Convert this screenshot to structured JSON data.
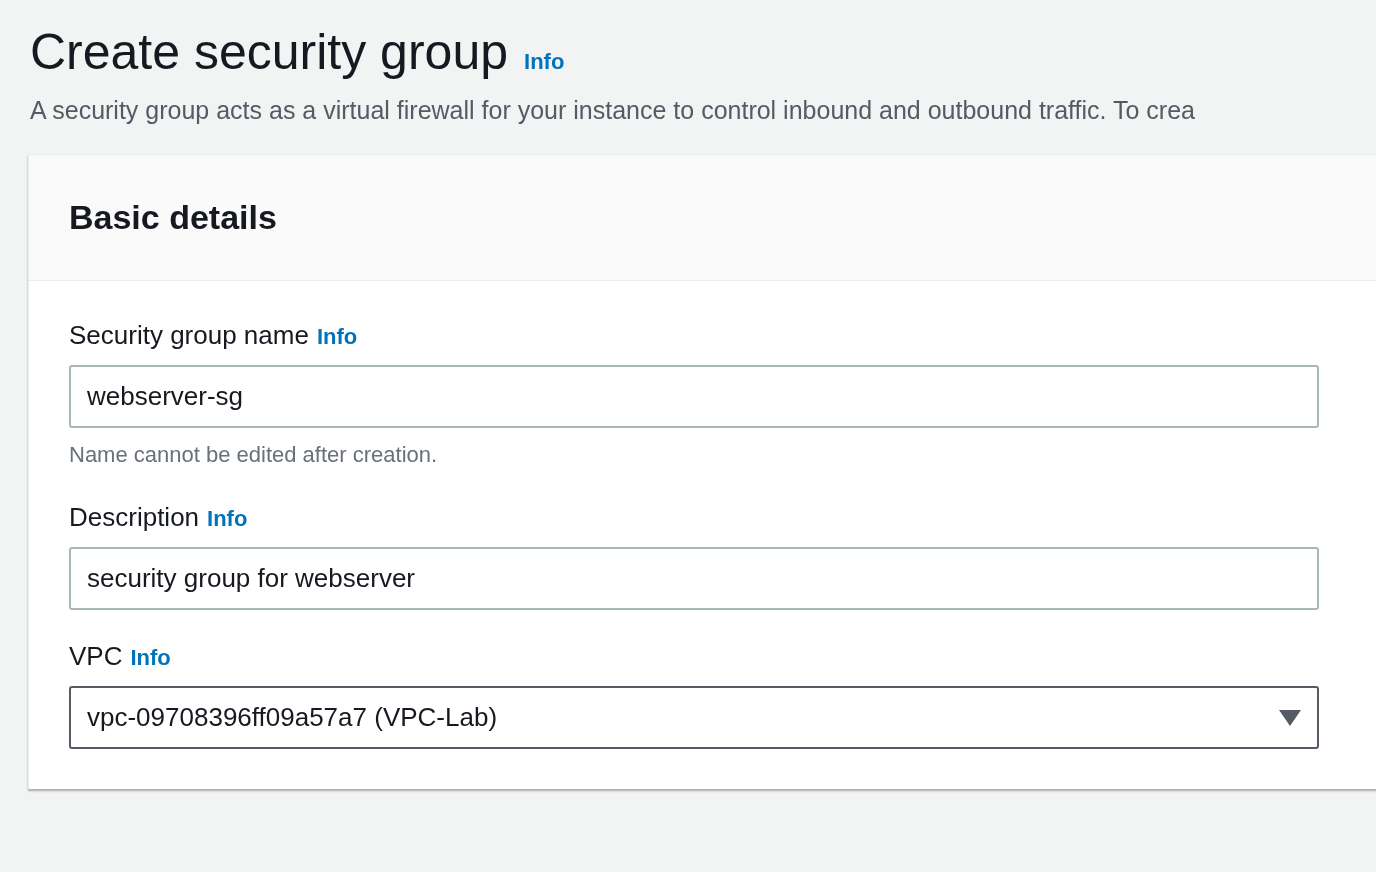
{
  "header": {
    "title": "Create security group",
    "info": "Info",
    "description": "A security group acts as a virtual firewall for your instance to control inbound and outbound traffic. To crea"
  },
  "panel": {
    "title": "Basic details",
    "fields": [
      {
        "kind": "text",
        "label": "Security group name",
        "info": "Info",
        "value": "webserver-sg",
        "hint": "Name cannot be edited after creation."
      },
      {
        "kind": "text",
        "label": "Description",
        "info": "Info",
        "value": "security group for webserver"
      },
      {
        "kind": "select",
        "label": "VPC",
        "info": "Info",
        "value": "vpc-09708396ff09a57a7 (VPC-Lab)"
      }
    ]
  }
}
